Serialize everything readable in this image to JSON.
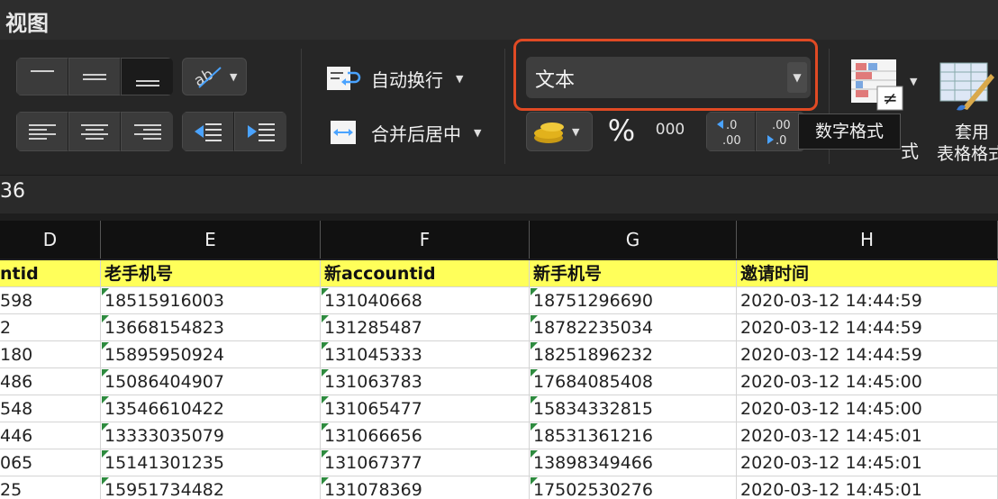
{
  "title": "视图",
  "ribbon": {
    "wrap_text_label": "自动换行",
    "merge_center_label": "合并后居中",
    "number_format_value": "文本",
    "percent_label": "%",
    "thousands_label": "000",
    "dec_inc_label": ".0\n.00",
    "dec_dec_label": ".00",
    "cond_format_partial": "式",
    "table_format_label_1": "套用",
    "table_format_label_2": "表格格式"
  },
  "tooltip": "数字格式",
  "name_box": "36",
  "columns": [
    "D",
    "E",
    "F",
    "G",
    "H"
  ],
  "header_row": [
    "ntid",
    "老手机号",
    "新accountid",
    "新手机号",
    "邀请时间"
  ],
  "rows": [
    [
      "598",
      "18515916003",
      "131040668",
      "18751296690",
      "2020-03-12 14:44:59"
    ],
    [
      "2",
      "13668154823",
      "131285487",
      "18782235034",
      "2020-03-12 14:44:59"
    ],
    [
      "180",
      "15895950924",
      "131045333",
      "18251896232",
      "2020-03-12 14:44:59"
    ],
    [
      "486",
      "15086404907",
      "131063783",
      "17684085408",
      "2020-03-12 14:45:00"
    ],
    [
      "548",
      "13546610422",
      "131065477",
      "15834332815",
      "2020-03-12 14:45:00"
    ],
    [
      "446",
      "13333035079",
      "131066656",
      "18531361216",
      "2020-03-12 14:45:01"
    ],
    [
      "065",
      "15141301235",
      "131067377",
      "13898349466",
      "2020-03-12 14:45:01"
    ],
    [
      "25",
      "15951734482",
      "131078369",
      "17502530276",
      "2020-03-12 14:45:01"
    ]
  ],
  "colors": {
    "highlight_border": "#e04a24",
    "header_fill": "#ffff5a",
    "text_marker": "#2e8b3f"
  }
}
